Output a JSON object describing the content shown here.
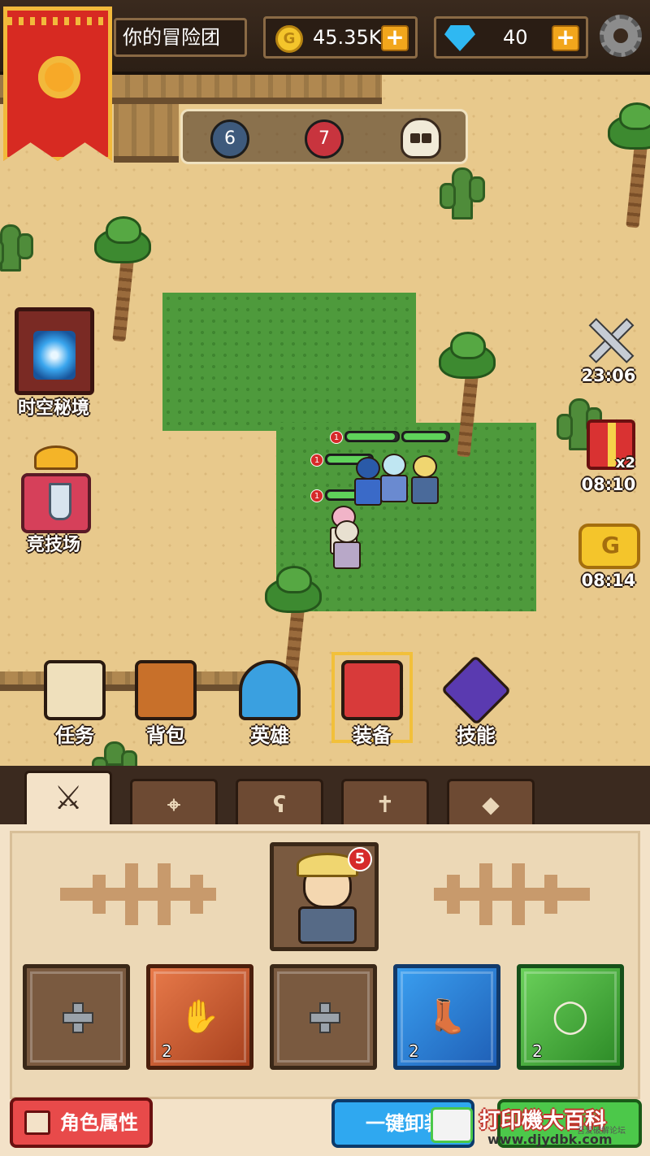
{
  "header": {
    "team_name": "你的冒险团",
    "gold": "45.35K",
    "gems": "40"
  },
  "wave": {
    "blue_count": "6",
    "red_count": "7",
    "boss_icon": "skull-icon"
  },
  "left_buttons": [
    {
      "label": "时空秘境",
      "icon": "portal-icon"
    },
    {
      "label": "竞技场",
      "icon": "arena-icon"
    }
  ],
  "right_timers": [
    {
      "time": "23:06",
      "icon": "crossed-swords-icon"
    },
    {
      "time": "08:10",
      "icon": "gift-icon",
      "multiplier": "x2"
    },
    {
      "time": "08:14",
      "icon": "gold-coin-stack-icon"
    }
  ],
  "party": {
    "levels": [
      "1",
      "1",
      "1"
    ]
  },
  "bottom_menu": [
    {
      "label": "任务",
      "icon": "quest-scroll-icon"
    },
    {
      "label": "背包",
      "icon": "treasure-chest-icon"
    },
    {
      "label": "英雄",
      "icon": "hero-helmet-icon"
    },
    {
      "label": "装备",
      "icon": "equipment-book-icon",
      "selected": true
    },
    {
      "label": "技能",
      "icon": "skill-crystal-icon"
    }
  ],
  "equip_tabs": [
    {
      "icon": "sword-icon",
      "active": true
    },
    {
      "icon": "bow-icon",
      "active": false
    },
    {
      "icon": "staff-icon",
      "active": false
    },
    {
      "icon": "holy-cross-icon",
      "active": false
    },
    {
      "icon": "axe-icon",
      "active": false
    }
  ],
  "hero_portrait": {
    "level_badge": "5"
  },
  "equip_slots": [
    {
      "rarity": "empty",
      "icon": "weapon-slot-icon",
      "count": ""
    },
    {
      "rarity": "orange",
      "icon": "gauntlets-icon",
      "count": "2"
    },
    {
      "rarity": "empty",
      "icon": "armor-slot-icon",
      "count": ""
    },
    {
      "rarity": "blue",
      "icon": "boots-icon",
      "count": "2"
    },
    {
      "rarity": "green",
      "icon": "ring-icon",
      "count": "2"
    }
  ],
  "actions": {
    "attributes_label": "角色属性",
    "unequip_label": "一键卸装"
  },
  "watermark": {
    "main": "打印機大百科",
    "sub": "吾爱破解论坛",
    "url": "www.djydbk.com"
  },
  "colors": {
    "gold": "#f4c52b",
    "gem": "#2fb8f2",
    "rarity_orange": "#e87a4a",
    "rarity_blue": "#3a9ff0",
    "rarity_green": "#6ad05a",
    "panel_bg": "#f3e2c8"
  }
}
